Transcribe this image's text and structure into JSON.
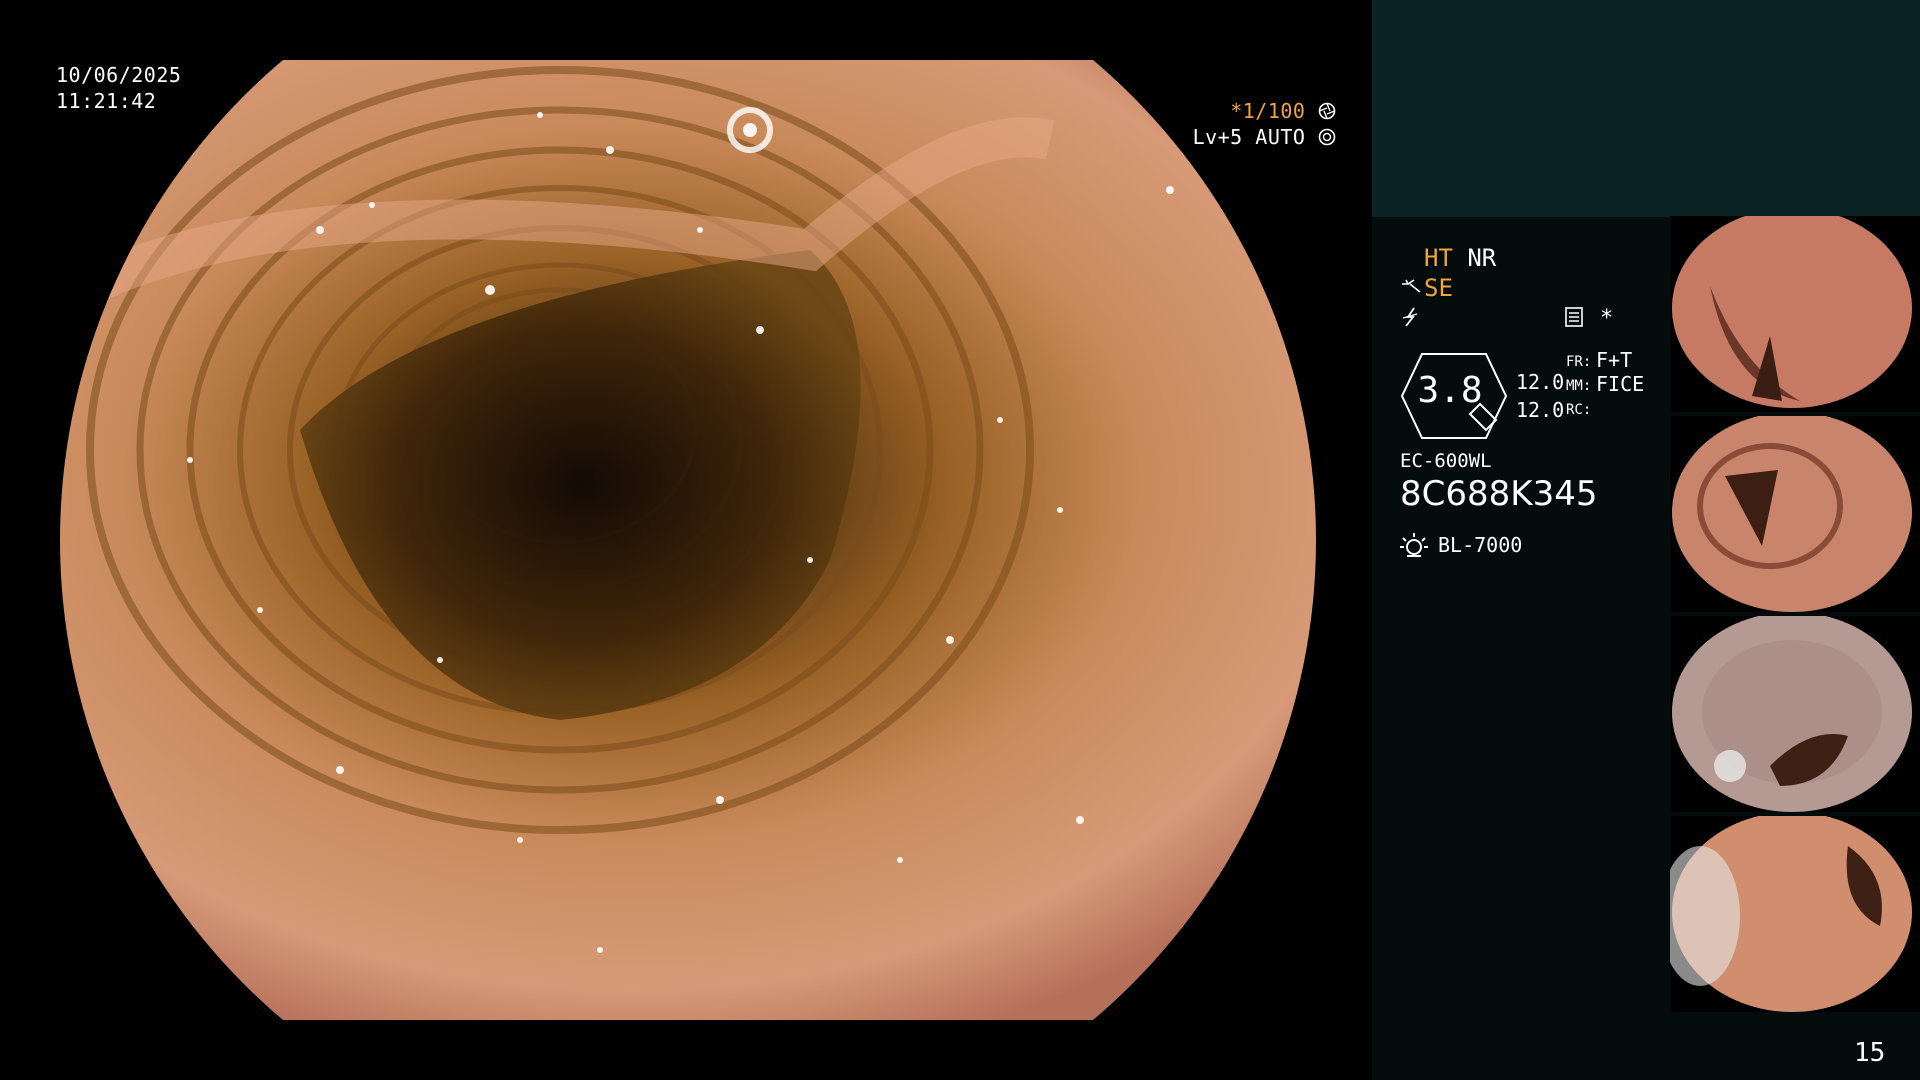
{
  "osd": {
    "date": "10/06/2025",
    "time": "11:21:42",
    "shutter_prefix": "*",
    "shutter_value": "1/100",
    "shutter_icon": "aperture-icon",
    "level_label": "Lv+5",
    "auto_label": "AUTO",
    "auto_icon": "iris-icon"
  },
  "status": {
    "ht_label": "HT",
    "nr_label": "NR",
    "se_label": "SE",
    "se_icon": "structure-icon",
    "flash_icon": "flash-icon",
    "menu_icon": "menu-icon",
    "star_label": "*",
    "zoom_value": "3.8",
    "num_a": "12.0",
    "num_b": "12.0",
    "fr_label": "FR:",
    "fr_value": "F+T",
    "mm_label": "MM:",
    "mm_value": "FICE",
    "rc_label": "RC:",
    "scope_model": "EC-600WL",
    "serial": "8C688K345",
    "light_icon": "light-source-icon",
    "light_source": "BL-7000",
    "page_number": "15"
  },
  "thumbnails": [
    {
      "name": "thumbnail-1"
    },
    {
      "name": "thumbnail-2"
    },
    {
      "name": "thumbnail-3"
    },
    {
      "name": "thumbnail-4"
    }
  ],
  "colors": {
    "accent_orange": "#f2a33a",
    "sidebar_top": "#0b2325",
    "sidebar_bg": "#040c0c"
  }
}
